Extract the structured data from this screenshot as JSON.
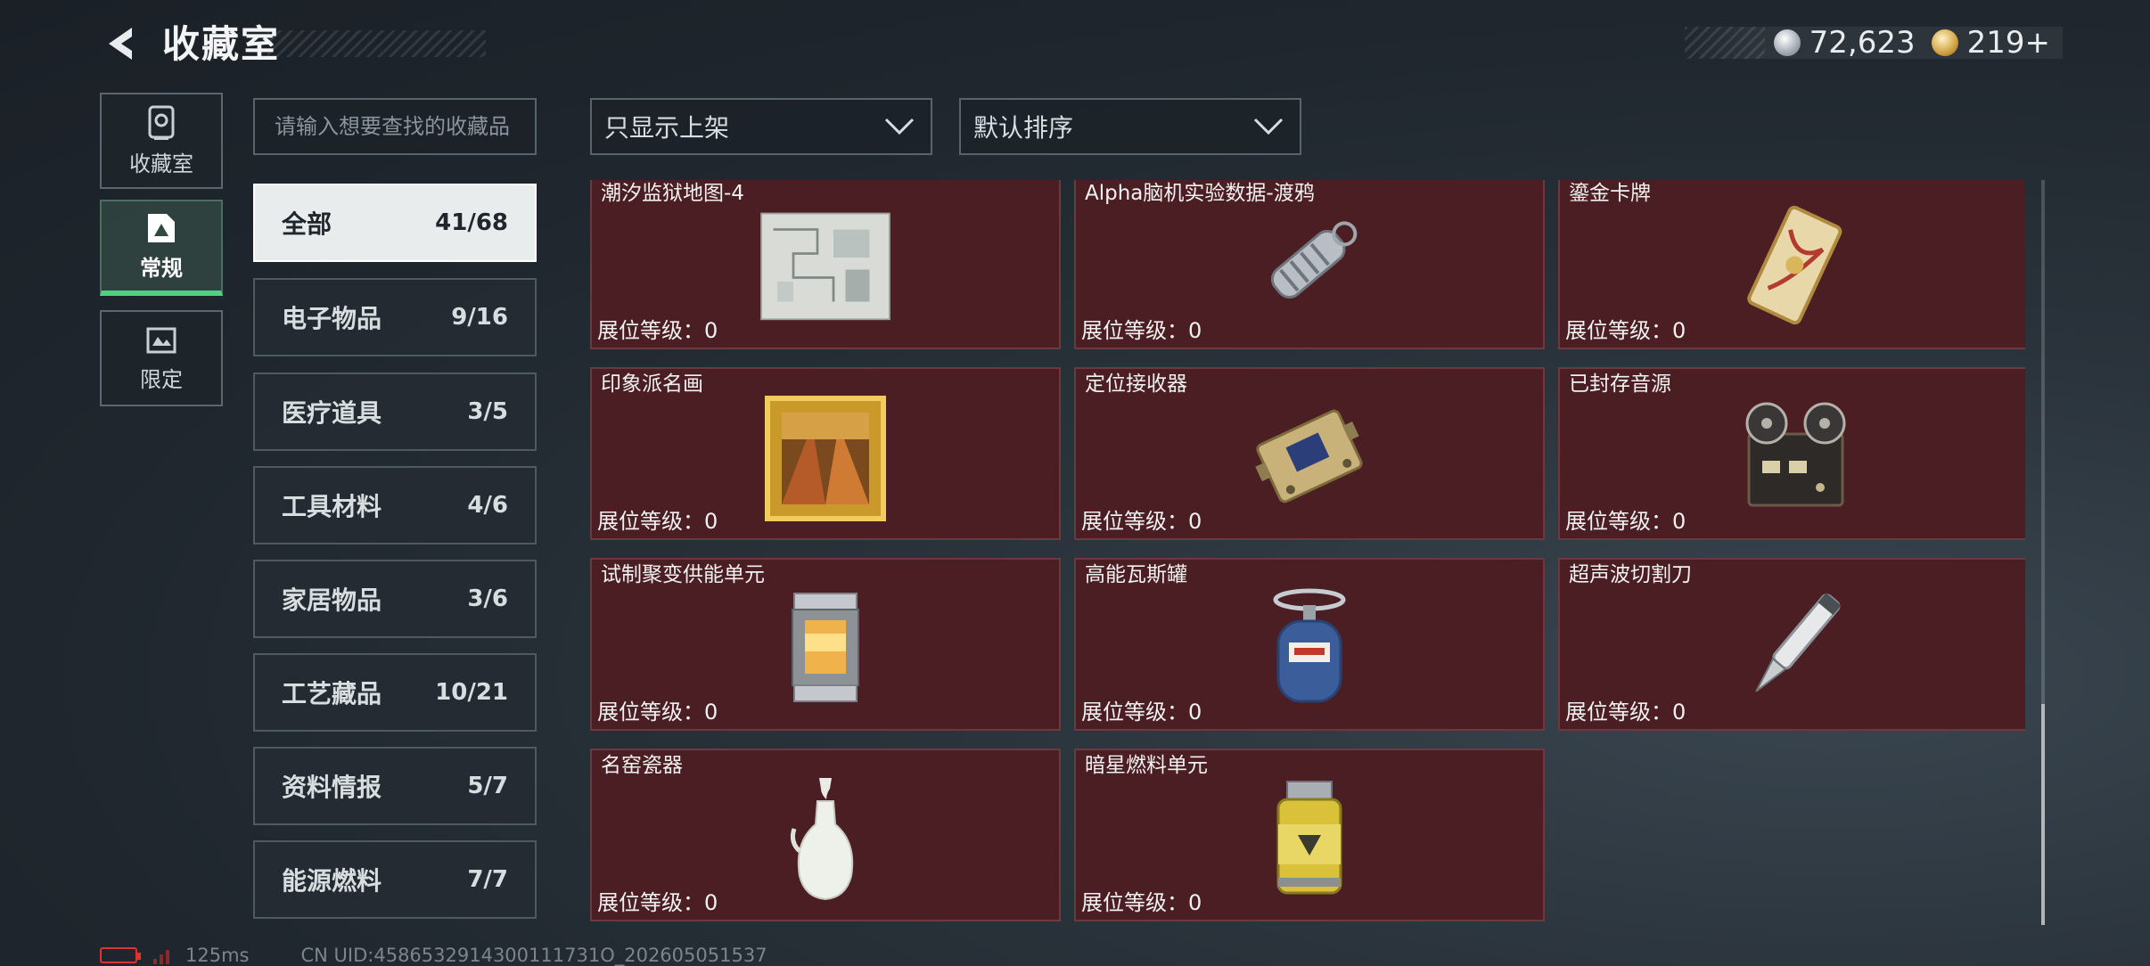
{
  "header": {
    "title": "收藏室",
    "currency": [
      {
        "icon": "silver-coin-icon",
        "value": "72,623"
      },
      {
        "icon": "gold-coin-icon",
        "value": "219+"
      }
    ]
  },
  "nav": [
    {
      "label": "收藏室",
      "icon": "vault-icon",
      "active": false
    },
    {
      "label": "常规",
      "icon": "general-icon",
      "active": true
    },
    {
      "label": "限定",
      "icon": "limited-icon",
      "active": false
    }
  ],
  "search": {
    "placeholder": "请输入想要查找的收藏品"
  },
  "filters": {
    "listing": "只显示上架",
    "sort": "默认排序"
  },
  "categories": [
    {
      "name": "全部",
      "count": "41/68",
      "active": true
    },
    {
      "name": "电子物品",
      "count": "9/16"
    },
    {
      "name": "医疗道具",
      "count": "3/5"
    },
    {
      "name": "工具材料",
      "count": "4/6"
    },
    {
      "name": "家居物品",
      "count": "3/6"
    },
    {
      "name": "工艺藏品",
      "count": "10/21"
    },
    {
      "name": "资料情报",
      "count": "5/7"
    },
    {
      "name": "能源燃料",
      "count": "7/7"
    }
  ],
  "items": [
    {
      "name": "潮汐监狱地图-4",
      "level": "展位等级：0",
      "icon": "map-icon"
    },
    {
      "name": "Alpha脑机实验数据-渡鸦",
      "level": "展位等级：0",
      "icon": "data-drive-icon"
    },
    {
      "name": "鎏金卡牌",
      "level": "展位等级：0",
      "icon": "gilded-card-icon"
    },
    {
      "name": "印象派名画",
      "level": "展位等级：0",
      "icon": "painting-icon"
    },
    {
      "name": "定位接收器",
      "level": "展位等级：0",
      "icon": "receiver-icon"
    },
    {
      "name": "已封存音源",
      "level": "展位等级：0",
      "icon": "tape-recorder-icon"
    },
    {
      "name": "试制聚变供能单元",
      "level": "展位等级：0",
      "icon": "fusion-cell-icon"
    },
    {
      "name": "高能瓦斯罐",
      "level": "展位等级：0",
      "icon": "gas-canister-icon"
    },
    {
      "name": "超声波切割刀",
      "level": "展位等级：0",
      "icon": "ultrasonic-knife-icon"
    },
    {
      "name": "名窑瓷器",
      "level": "展位等级：0",
      "icon": "porcelain-vase-icon"
    },
    {
      "name": "暗星燃料单元",
      "level": "展位等级：0",
      "icon": "fuel-canister-icon"
    }
  ],
  "footer": {
    "ping": "125ms",
    "uid": "CN UID:4586532914300111731O_202605051537"
  }
}
